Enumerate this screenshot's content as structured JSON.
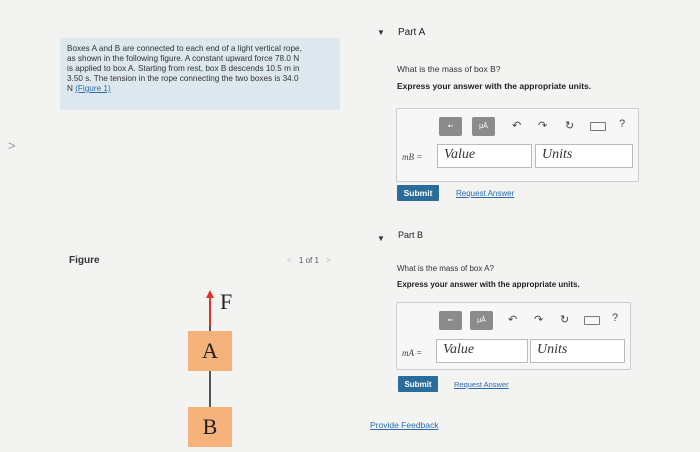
{
  "problem": {
    "lines": [
      "Boxes A and B are connected to each end of a light vertical rope,",
      "as shown in the following figure. A constant upward force 78.0 N",
      "is applied to box A. Starting from rest, box B descends 10.5 m in",
      "3.50 s. The tension in the rope connecting the two boxes is 34.0",
      "N"
    ],
    "figure_link": "(Figure 1)"
  },
  "figure": {
    "label": "Figure",
    "pager": {
      "prev": "<",
      "count": "1 of 1",
      "next": ">"
    },
    "force_label": "F",
    "box_a": "A",
    "box_b": "B"
  },
  "left_arrow": ">",
  "parts": [
    {
      "title": "Part A",
      "toggle": "▼",
      "question": "What is the mass of box B?",
      "instruction": "Express your answer with the appropriate units.",
      "variable": "mB =",
      "value_placeholder": "Value",
      "units_placeholder": "Units",
      "submit": "Submit",
      "request": "Request Answer",
      "tools": {
        "templates": "▪▫",
        "symbols": "μÅ",
        "undo": "↶",
        "redo": "↷",
        "reset": "↻",
        "help": "?"
      }
    },
    {
      "title": "Part B",
      "toggle": "▼",
      "question": "What is the mass of box A?",
      "instruction": "Express your answer with the appropriate units.",
      "variable": "mA =",
      "value_placeholder": "Value",
      "units_placeholder": "Units",
      "submit": "Submit",
      "request": "Request Answer",
      "tools": {
        "templates": "▪▫",
        "symbols": "μÅ",
        "undo": "↶",
        "redo": "↷",
        "reset": "↻",
        "help": "?"
      }
    }
  ],
  "feedback_link": "Provide Feedback"
}
